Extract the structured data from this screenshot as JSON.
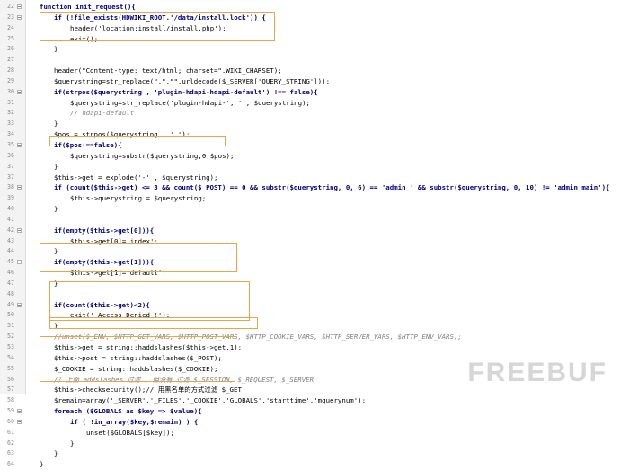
{
  "lines": [
    {
      "n": "22",
      "indent": 1,
      "text": "function init_request(){",
      "cls": "k",
      "fold": true
    },
    {
      "n": "23",
      "indent": 2,
      "text": "if (!file_exists(HDWIKI_ROOT.'/data/install.lock')) {",
      "cls": "k",
      "fold": true
    },
    {
      "n": "24",
      "indent": 3,
      "text": "header('location:install/install.php');",
      "cls": "",
      "fold": false
    },
    {
      "n": "25",
      "indent": 3,
      "text": "exit();",
      "cls": "",
      "fold": false
    },
    {
      "n": "26",
      "indent": 2,
      "text": "}",
      "cls": "",
      "fold": false
    },
    {
      "n": "27",
      "indent": 1,
      "text": "",
      "cls": "",
      "fold": false
    },
    {
      "n": "28",
      "indent": 2,
      "text": "header(\"Content-type: text/html; charset=\".WIKI_CHARSET);",
      "cls": "",
      "fold": false
    },
    {
      "n": "29",
      "indent": 2,
      "text": "$querystring=str_replace(\".\",\"\",urldecode($_SERVER['QUERY_STRING']));",
      "cls": "",
      "fold": false
    },
    {
      "n": "30",
      "indent": 2,
      "text": "if(strpos($querystring , 'plugin-hdapi-hdapi-default') !== false){",
      "cls": "k",
      "fold": true
    },
    {
      "n": "31",
      "indent": 3,
      "text": "$querystring=str_replace('plugin-hdapi-', '', $querystring);",
      "cls": "",
      "fold": false
    },
    {
      "n": "32",
      "indent": 3,
      "text": "// hdapi-default",
      "cls": "c",
      "fold": false
    },
    {
      "n": "33",
      "indent": 2,
      "text": "}",
      "cls": "",
      "fold": false
    },
    {
      "n": "34",
      "indent": 2,
      "text": "$pos = strpos($querystring , '.');",
      "cls": "",
      "fold": false
    },
    {
      "n": "35",
      "indent": 2,
      "text": "if($pos!==false){",
      "cls": "k",
      "fold": true
    },
    {
      "n": "36",
      "indent": 3,
      "text": "$querystring=substr($querystring,0,$pos);",
      "cls": "",
      "fold": false
    },
    {
      "n": "37",
      "indent": 2,
      "text": "}",
      "cls": "",
      "fold": false
    },
    {
      "n": "37",
      "indent": 2,
      "text": "$this->get = explode('-' , $querystring);",
      "cls": "",
      "fold": false
    },
    {
      "n": "38",
      "indent": 2,
      "text": "if (count($this->get) <= 3 && count($_POST) == 0 && substr($querystring, 0, 6) == 'admin_' && substr($querystring, 0, 10) != 'admin_main'){",
      "cls": "k",
      "fold": true
    },
    {
      "n": "39",
      "indent": 3,
      "text": "$this->querystring = $querystring;",
      "cls": "",
      "fold": false
    },
    {
      "n": "40",
      "indent": 2,
      "text": "}",
      "cls": "",
      "fold": false
    },
    {
      "n": "41",
      "indent": 1,
      "text": "",
      "cls": "",
      "fold": false
    },
    {
      "n": "42",
      "indent": 2,
      "text": "if(empty($this->get[0])){",
      "cls": "k",
      "fold": true
    },
    {
      "n": "43",
      "indent": 3,
      "text": "$this->get[0]='index';",
      "cls": "",
      "fold": false
    },
    {
      "n": "44",
      "indent": 2,
      "text": "}",
      "cls": "",
      "fold": false
    },
    {
      "n": "45",
      "indent": 2,
      "text": "if(empty($this->get[1])){",
      "cls": "k",
      "fold": true
    },
    {
      "n": "46",
      "indent": 3,
      "text": "$this->get[1]='default';",
      "cls": "",
      "fold": false
    },
    {
      "n": "47",
      "indent": 2,
      "text": "}",
      "cls": "",
      "fold": false
    },
    {
      "n": "48",
      "indent": 1,
      "text": "",
      "cls": "",
      "fold": false
    },
    {
      "n": "49",
      "indent": 2,
      "text": "if(count($this->get)<2){",
      "cls": "k",
      "fold": true
    },
    {
      "n": "50",
      "indent": 3,
      "text": "exit(' Access Denied !');",
      "cls": "",
      "fold": false
    },
    {
      "n": "51",
      "indent": 2,
      "text": "}",
      "cls": "",
      "fold": false
    },
    {
      "n": "52",
      "indent": 2,
      "text": "//unset($_ENV, $HTTP_GET_VARS, $HTTP_POST_VARS, $HTTP_COOKIE_VARS, $HTTP_SERVER_VARS, $HTTP_ENV_VARS);",
      "cls": "c",
      "fold": false
    },
    {
      "n": "53",
      "indent": 2,
      "text": "$this->get = string::haddslashes($this->get,1);",
      "cls": "",
      "fold": false
    },
    {
      "n": "54",
      "indent": 2,
      "text": "$this->post = string::haddslashes($_POST);",
      "cls": "",
      "fold": false
    },
    {
      "n": "55",
      "indent": 2,
      "text": "$_COOKIE = string::haddslashes($_COOKIE);",
      "cls": "",
      "fold": false
    },
    {
      "n": "56",
      "indent": 2,
      "text": "// 上面 addslashes 过滤 , 但没有 过滤 $_SESSION, $_REQUEST, $_SERVER",
      "cls": "c",
      "fold": false
    },
    {
      "n": "57",
      "indent": 2,
      "text": "$this->checksecurity();// 用黑名单的方式过滤 $_GET",
      "cls": "",
      "fold": false
    },
    {
      "n": "58",
      "indent": 2,
      "text": "$remain=array('_SERVER','_FILES','_COOKIE','GLOBALS','starttime','mquerynum');",
      "cls": "",
      "fold": false
    },
    {
      "n": "59",
      "indent": 2,
      "text": "foreach ($GLOBALS as $key => $value){",
      "cls": "k",
      "fold": true
    },
    {
      "n": "60",
      "indent": 3,
      "text": "if ( !in_array($key,$remain) ) {",
      "cls": "k",
      "fold": true
    },
    {
      "n": "61",
      "indent": 4,
      "text": "unset($GLOBALS[$key]);",
      "cls": "",
      "fold": false
    },
    {
      "n": "62",
      "indent": 3,
      "text": "}",
      "cls": "",
      "fold": false
    },
    {
      "n": "63",
      "indent": 2,
      "text": "}",
      "cls": "",
      "fold": false
    },
    {
      "n": "64",
      "indent": 1,
      "text": "}",
      "cls": "",
      "fold": false
    }
  ],
  "watermark": "FREEBUF",
  "colors": {
    "keyword": "#000080",
    "comment": "#808080",
    "highlight_box": "#e8a64a",
    "gutter": "#f3f3f3"
  }
}
